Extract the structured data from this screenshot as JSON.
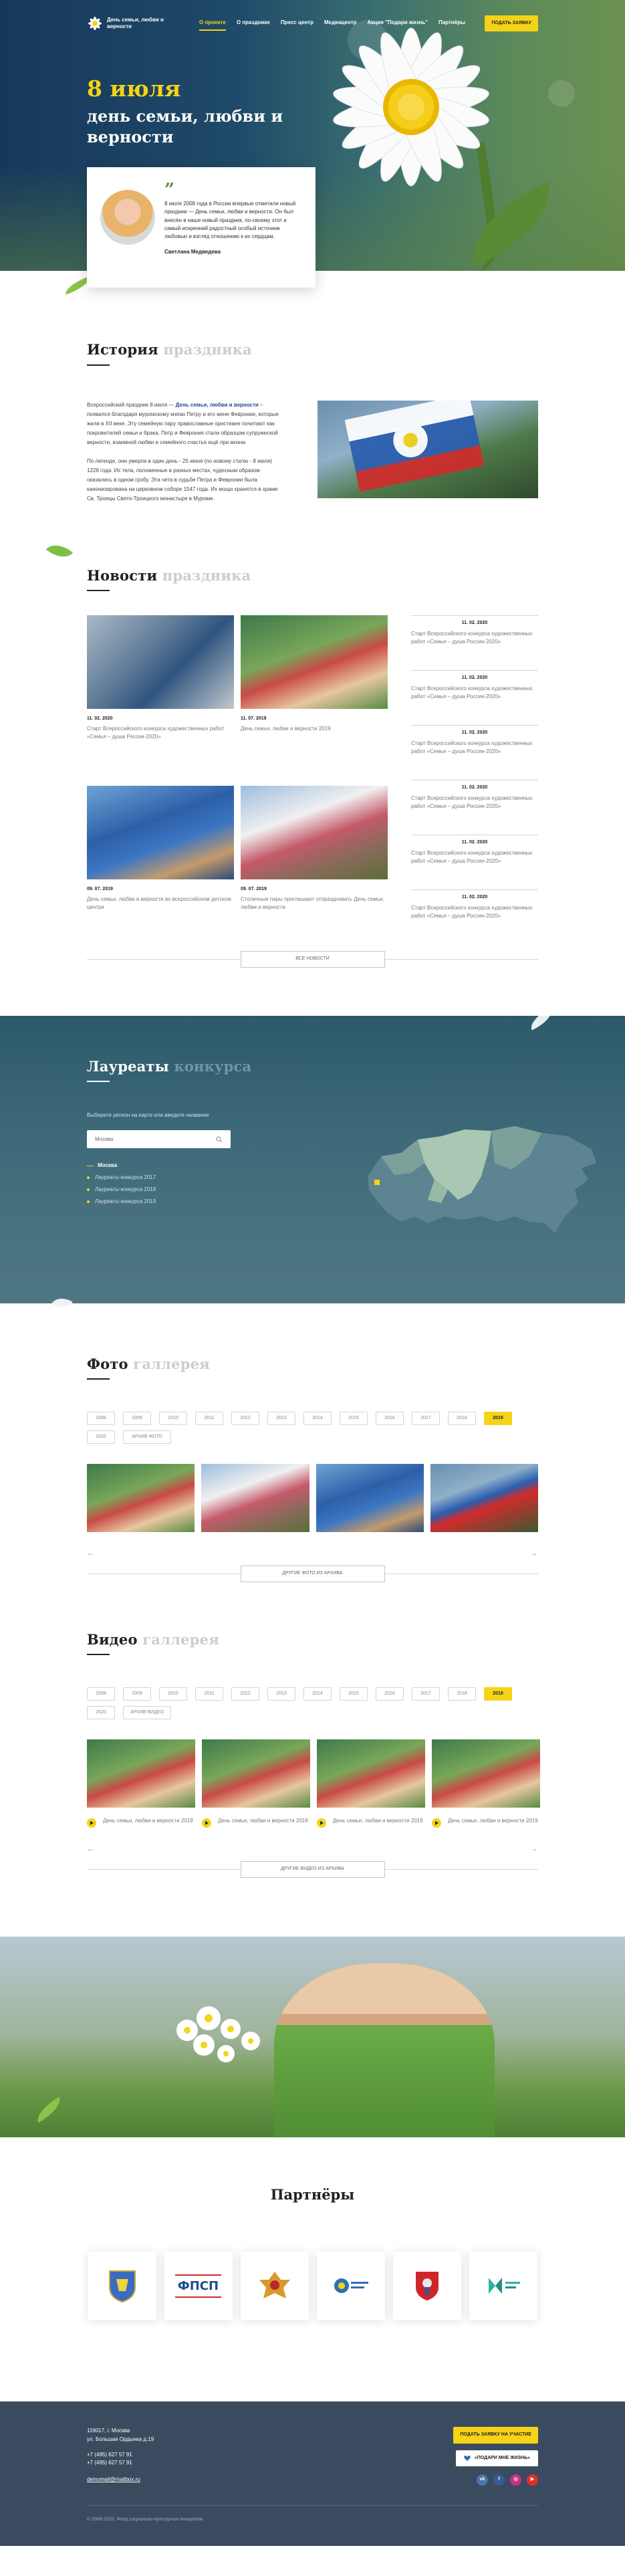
{
  "header": {
    "logo_text": "День семьи, любви и верности",
    "menu": [
      {
        "label": "О проекте",
        "active": true
      },
      {
        "label": "О празднике",
        "active": false
      },
      {
        "label": "Пресс центр",
        "active": false
      },
      {
        "label": "Медиацентр",
        "active": false
      },
      {
        "label": "Акция \"Подари жизнь\"",
        "active": false
      },
      {
        "label": "Партнёры",
        "active": false
      }
    ],
    "cta": "ПОДАТЬ ЗАЯВКУ"
  },
  "hero": {
    "date": "8 июля",
    "title": "день семьи, любви и верности",
    "quote": "8 июля 2008 года в России впервые отметили новый праздник — День семьи, любви и верности. Он был внесён в наше новый праздник, по-своему этот и самый искренний радостный особый источник любовью и взгляд отношению к их сердцам.",
    "author": "Светлана Медведева"
  },
  "history": {
    "title": "История",
    "title_muted": "праздника",
    "p1_start": "Всероссийский праздник 8 июля — ",
    "p1_bold": "День семьи, любви и верности",
    "p1_end": " – появился благодаря муромскому князю Петру и его жене Февронии, которые жили в XII веке. Эту семейную пару православные христиане почитают как покровителей семьи и брака. Петр и Феврония стали образцом супружеской верности, взаимной любви и семейного счастья ещё при жизни.",
    "p2": "По легенде, они умерли в один день - 25 июня (по новому стилю - 8 июля) 1228 года. Их тела, положенные в разных местах, чудесным образом оказались в одном гробу. Эта чета в судьбе Петра и Февронии была канонизирована на церковном соборе 1547 года. Их мощи хранятся в храме Св. Троицы Свято-Троицкого монастыря в Муроме."
  },
  "news": {
    "title": "Новости",
    "title_muted": "праздника",
    "cards": [
      {
        "date": "11. 02. 2020",
        "text": "Старт Всероссийского конкурса художественных работ «Семья – душа России-2020»"
      },
      {
        "date": "11. 07. 2019",
        "text": "День семьи, любви и верности 2019"
      },
      {
        "date": "09. 07. 2019",
        "text": "День семьи, любви и верности во всероссийском детском центре"
      },
      {
        "date": "09. 07. 2019",
        "text": "Столичные пары приглашают отпраздновать День семьи, любви и верности"
      }
    ],
    "list": [
      {
        "date": "11. 02. 2020",
        "text": "Старт Всероссийского конкурса художественных работ «Семья – душа России-2020»"
      },
      {
        "date": "11. 02. 2020",
        "text": "Старт Всероссийского конкурса художественных работ «Семья – душа России-2020»"
      },
      {
        "date": "11. 02. 2020",
        "text": "Старт Всероссийского конкурса художественных работ «Семья – душа России-2020»"
      },
      {
        "date": "11. 02. 2020",
        "text": "Старт Всероссийского конкурса художественных работ «Семья – душа России-2020»"
      },
      {
        "date": "11. 02. 2020",
        "text": "Старт Всероссийского конкурса художественных работ «Семья – душа России-2020»"
      },
      {
        "date": "11. 02. 2020",
        "text": "Старт Всероссийского конкурса художественных работ «Семья – душа России-2020»"
      }
    ],
    "all_button": "ВСЕ НОВОСТИ"
  },
  "laureates": {
    "title": "Лауреаты",
    "title_muted": "конкурса",
    "hint": "Выберите регион на карте или введите название",
    "search_value": "Москва",
    "city": "Москва",
    "items": [
      "Лауреаты конкурса 2017",
      "Лауреаты конкурса 2018",
      "Лауреаты конкурса 2019"
    ]
  },
  "photo": {
    "title": "Фото",
    "title_muted": "галлерея",
    "years": [
      "2008",
      "2009",
      "2010",
      "2011",
      "2012",
      "2013",
      "2014",
      "2015",
      "2016",
      "2017",
      "2018",
      "2019",
      "2020"
    ],
    "active_year": "2019",
    "archive": "АРХИВ ФОТО",
    "more_button": "ДРУГИЕ ФОТО ИЗ АРХИВА"
  },
  "video": {
    "title": "Видео",
    "title_muted": "галлерея",
    "years": [
      "2008",
      "2009",
      "2010",
      "2011",
      "2012",
      "2013",
      "2014",
      "2015",
      "2016",
      "2017",
      "2018",
      "2019",
      "2020"
    ],
    "active_year": "2019",
    "archive": "АРХИВ ВИДЕО",
    "captions": [
      "День семьи, любви и верности 2019",
      "День семьи, любви и верности 2019",
      "День семьи, любви и верности 2019",
      "День семьи, любви и верности 2019"
    ],
    "more_button": "ДРУГИЕ ВИДЕО ИЗ АРХИВА"
  },
  "partners": {
    "title": "Партнёры",
    "items": [
      "ФПСП"
    ]
  },
  "footer": {
    "address1": "119017, г. Москва",
    "address2": "ул. Большая Ордынка д.19",
    "phone1": "+7 (495) 627 57 91",
    "phone2": "+7 (495) 627 57 91",
    "email": "demomail@mailbox.ru",
    "cta_primary": "ПОДАТЬ ЗАЯВКУ НА УЧАСТИЕ",
    "cta_secondary": "«ПОДАРИ МНЕ ЖИЗНЬ»",
    "copyright": "© 2008-2020, Фонд социально-культурных инициатив"
  }
}
